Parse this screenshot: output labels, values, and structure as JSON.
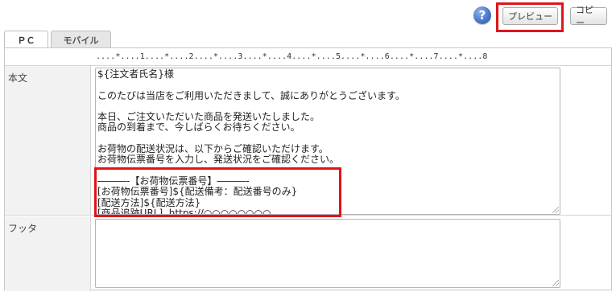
{
  "toolbar": {
    "help_label": "?",
    "preview_label": "プレビュー",
    "copy_label": "コピー",
    "highlight_color": "#e0141b"
  },
  "tabs": [
    {
      "label": "ＰＣ",
      "active": true
    },
    {
      "label": "モバイル",
      "active": false
    }
  ],
  "ruler": "....*....1....*....2....*....3....*....4....*....5....*....6....*....7....*....8",
  "fields": {
    "body": {
      "label": "本文",
      "lines": [
        "${注文者氏名}様",
        "",
        "このたびは当店をご利用いただきまして、誠にありがとうございます。",
        "",
        "本日、ご注文いただいた商品を発送いたしました。",
        "商品の到着まで、今しばらくお待ちください。",
        "",
        "お荷物の配送状況は、以下からご確認いただけます。",
        "お荷物伝票番号を入力し、発送状況をご確認ください。",
        "",
        "―――-【お荷物伝票番号】―――-",
        "[お荷物伝票番号]${配送備考：配送番号のみ}",
        "[配送方法]${配送方法}",
        "[商品追跡URL]  https://○○○○○○○○"
      ]
    },
    "footer": {
      "label": "フッタ",
      "value": ""
    }
  }
}
